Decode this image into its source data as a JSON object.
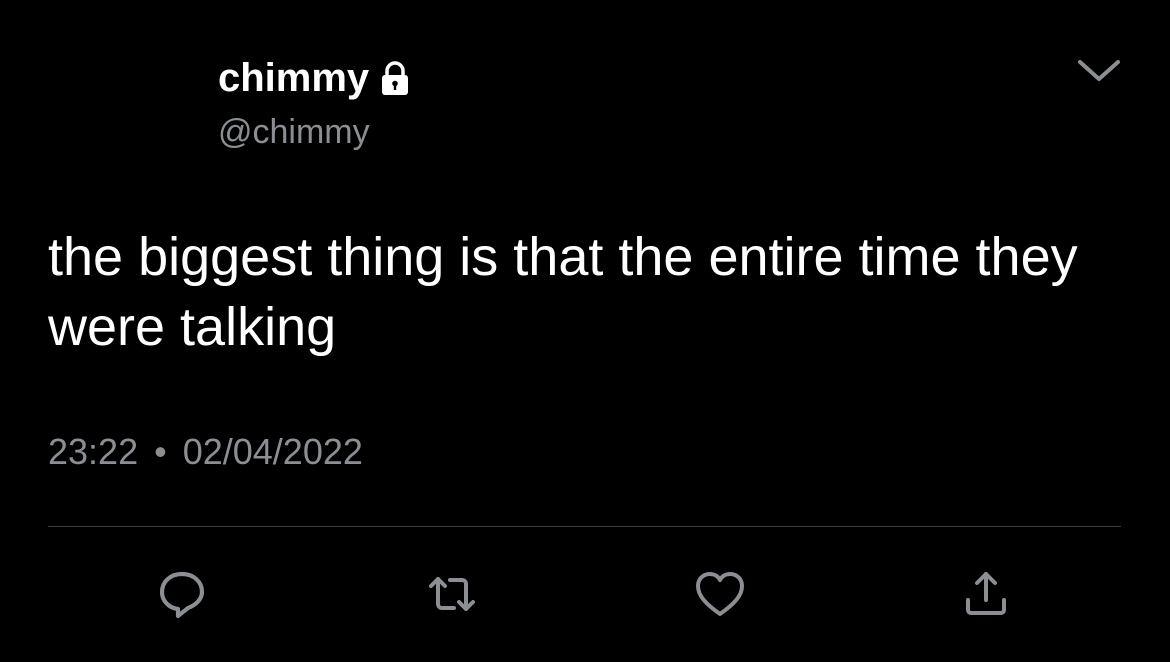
{
  "author": {
    "display_name": "chimmy",
    "handle": "@chimmy",
    "protected_icon": "lock-icon"
  },
  "menu_icon": "chevron-down-icon",
  "tweet": {
    "text": "the biggest thing is that the entire time they were talking",
    "time": "23:22",
    "separator": "•",
    "date": "02/04/2022"
  },
  "actions": [
    {
      "name": "reply",
      "icon": "comment-icon"
    },
    {
      "name": "retweet",
      "icon": "retweet-icon"
    },
    {
      "name": "like",
      "icon": "heart-icon"
    },
    {
      "name": "share",
      "icon": "share-icon"
    }
  ],
  "colors": {
    "background": "#000000",
    "text_primary": "#ffffff",
    "text_secondary": "#8b8f94",
    "icon": "#8b8f94",
    "divider": "#3a3d41"
  }
}
